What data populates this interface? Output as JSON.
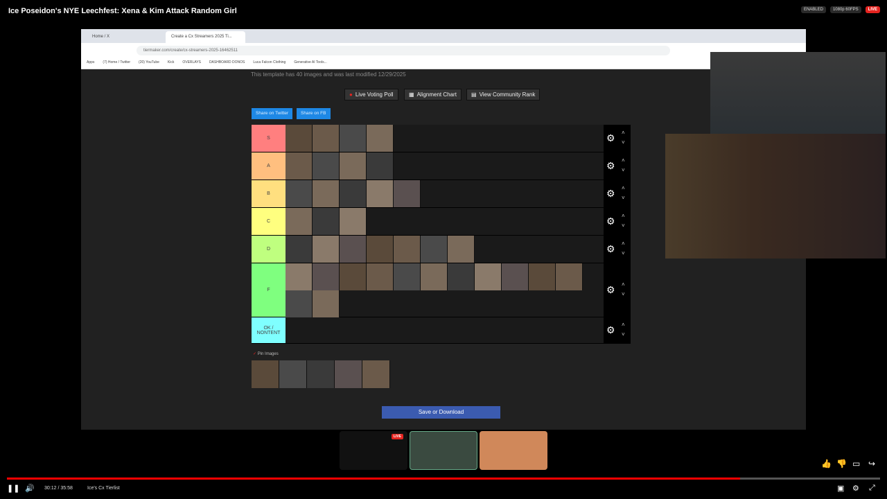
{
  "video": {
    "title": "Ice Poseidon's NYE Leechfest: Xena & Kim Attack Random Girl",
    "badges": [
      "ENABLED",
      "1080p 60FPS"
    ],
    "live_badge": "LIVE",
    "time": "30:12 / 35:58",
    "chapter": "Ice's Cx Tierlist",
    "progress_fraction": 0.84
  },
  "browser": {
    "tabs": [
      "Home / X",
      "Create a Cx Streamers 2025 Ti..."
    ],
    "url": "tiermaker.com/create/cx-streamers-2025-16462511",
    "bookmarks": [
      "Apps",
      "(7) Home / Twitter",
      "(20) YouTube",
      "Kick",
      "OVERLAYS",
      "DASHBOARD DONOS",
      "Luca Falcon Clothing",
      "Generative AI Tools..."
    ]
  },
  "page": {
    "template_info": "This template has 40 images and was last modified 12/29/2025",
    "buttons": [
      "Live Voting Poll",
      "Alignment Chart",
      "View Community Rank"
    ],
    "share": [
      "Share on Twitter",
      "Share on FB"
    ],
    "pin_images": "Pin Images",
    "save_button": "Save or Download"
  },
  "tiers": [
    {
      "label": "S",
      "color": "#ff7f7f",
      "count": 4
    },
    {
      "label": "A",
      "color": "#ffbf7f",
      "count": 4
    },
    {
      "label": "B",
      "color": "#ffdf7f",
      "count": 5
    },
    {
      "label": "C",
      "color": "#ffff7f",
      "count": 3
    },
    {
      "label": "D",
      "color": "#bfff7f",
      "count": 7
    },
    {
      "label": "F",
      "color": "#7fff7f",
      "count": 13
    },
    {
      "label": "OK / NONTENT",
      "color": "#7fffff",
      "count": 0
    }
  ],
  "pool_count": 5,
  "stream_bar": {
    "live": "LIVE"
  },
  "icons": [
    "gear-icon",
    "pause-icon",
    "volume-icon",
    "settings-icon",
    "fullscreen-icon"
  ]
}
